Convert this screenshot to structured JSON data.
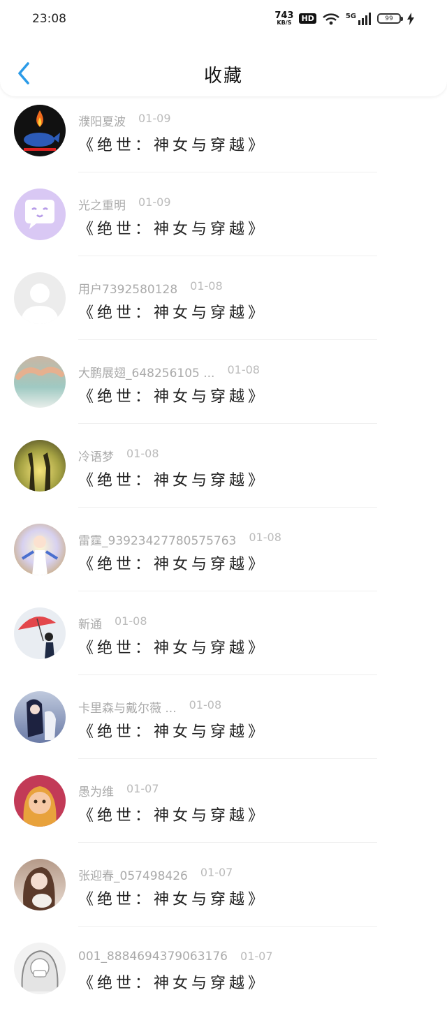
{
  "status_bar": {
    "time": "23:08",
    "net_speed": "743",
    "net_unit": "KB/S",
    "hd": "HD",
    "signal": "5G",
    "battery": "99"
  },
  "header": {
    "title": "收藏"
  },
  "colors": {
    "accent": "#2b9be8",
    "meta_text": "#aaaaaa"
  },
  "items": [
    {
      "name": "濮阳夏波",
      "date": "01-09",
      "book": "《绝世：神女与穿越》"
    },
    {
      "name": "光之重明",
      "date": "01-09",
      "book": "《绝世：神女与穿越》"
    },
    {
      "name": "用户7392580128",
      "date": "01-08",
      "book": "《绝世：神女与穿越》"
    },
    {
      "name": "大鹏展翅_648256105 ...",
      "date": "01-08",
      "book": "《绝世：神女与穿越》"
    },
    {
      "name": "冷语梦",
      "date": "01-08",
      "book": "《绝世：神女与穿越》"
    },
    {
      "name": "雷霆_93923427780575763",
      "date": "01-08",
      "book": "《绝世：神女与穿越》"
    },
    {
      "name": "新通",
      "date": "01-08",
      "book": "《绝世：神女与穿越》"
    },
    {
      "name": "卡里森与戴尔薇 ...",
      "date": "01-08",
      "book": "《绝世：神女与穿越》"
    },
    {
      "name": "愚为维",
      "date": "01-07",
      "book": "《绝世：神女与穿越》"
    },
    {
      "name": "张迎春_057498426",
      "date": "01-07",
      "book": "《绝世：神女与穿越》"
    },
    {
      "name": "001_8884694379063176",
      "date": "01-07",
      "book": "《绝世：神女与穿越》"
    }
  ]
}
